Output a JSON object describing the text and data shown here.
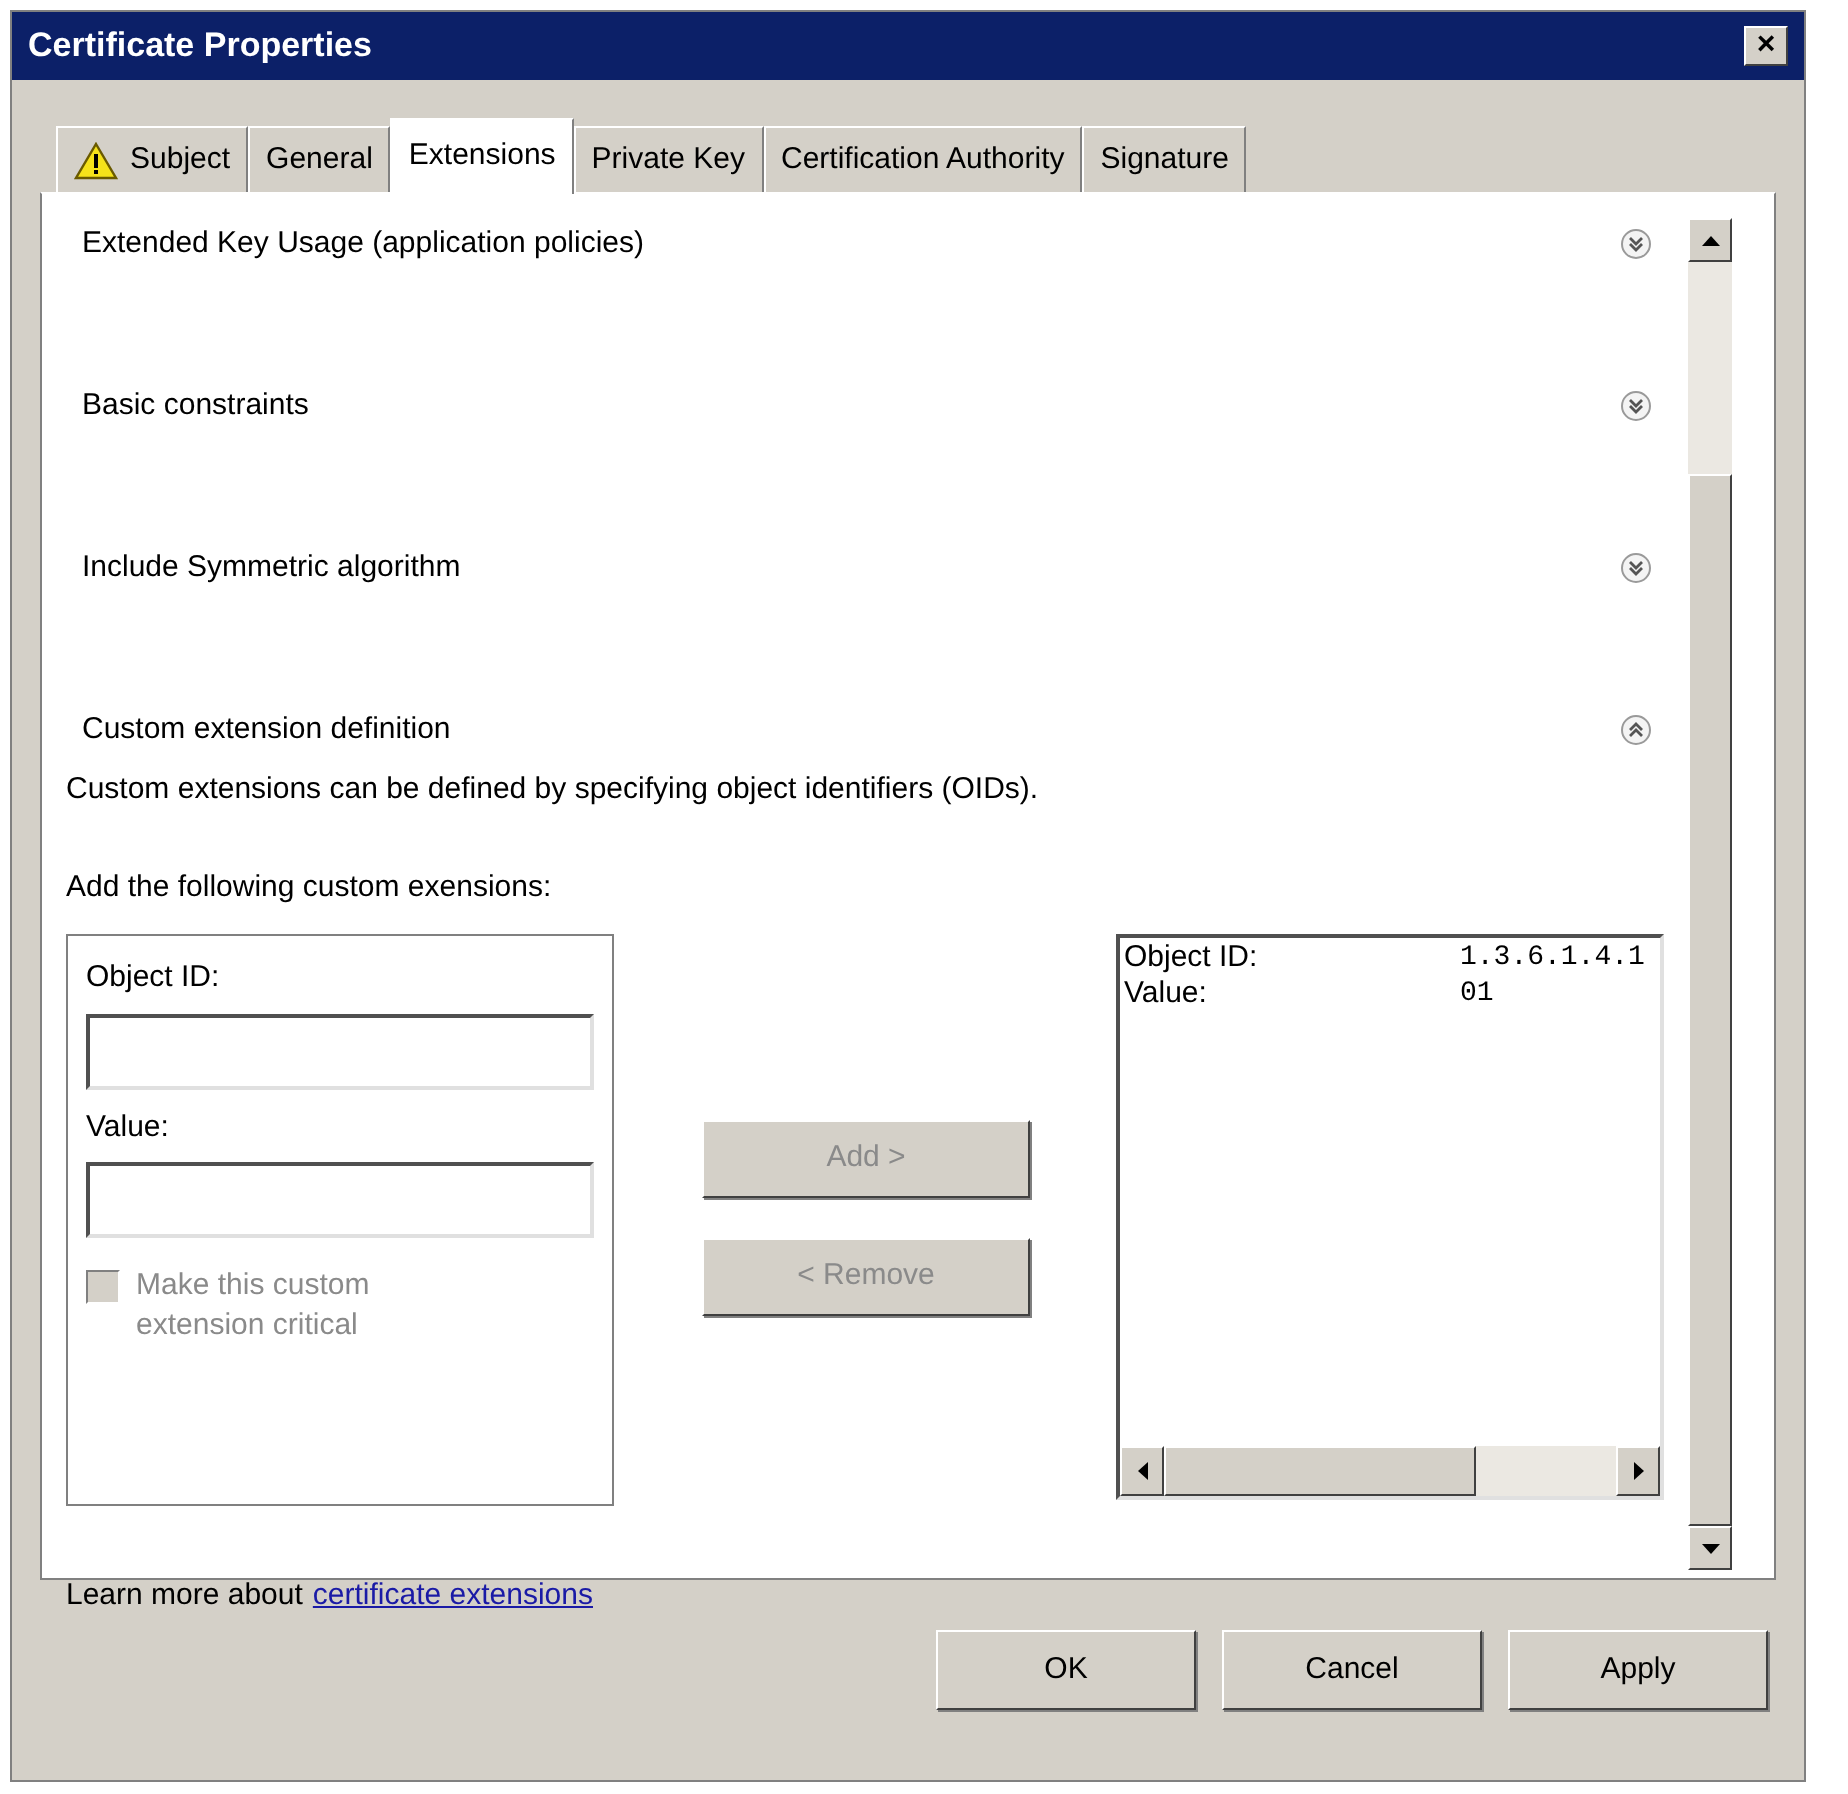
{
  "window": {
    "title": "Certificate Properties",
    "close_label": "×"
  },
  "tabs": [
    {
      "label": "Subject",
      "selected": false,
      "warning": true
    },
    {
      "label": "General",
      "selected": false,
      "warning": false
    },
    {
      "label": "Extensions",
      "selected": true,
      "warning": false
    },
    {
      "label": "Private Key",
      "selected": false,
      "warning": false
    },
    {
      "label": "Certification Authority",
      "selected": false,
      "warning": false
    },
    {
      "label": "Signature",
      "selected": false,
      "warning": false
    }
  ],
  "sections": [
    {
      "title": "Extended Key Usage (application policies)",
      "expanded": false
    },
    {
      "title": "Basic constraints",
      "expanded": false
    },
    {
      "title": "Include Symmetric algorithm",
      "expanded": false
    },
    {
      "title": "Custom extension definition",
      "expanded": true
    }
  ],
  "custom": {
    "description": "Custom extensions can be defined by specifying object identifiers (OIDs).",
    "add_label": "Add the following custom exensions:",
    "object_id_label": "Object ID:",
    "value_label": "Value:",
    "critical": {
      "label": "Make this custom extension critical",
      "checked": false,
      "disabled": true
    },
    "buttons": [
      {
        "label": "Add >",
        "disabled": true
      },
      {
        "label": "< Remove",
        "disabled": true
      }
    ],
    "list": [
      {
        "label": "Object ID:",
        "value": "1.3.6.1.4.1"
      },
      {
        "label": "Value:",
        "value": "01"
      }
    ]
  },
  "learn_more": {
    "text": "Learn more about",
    "link": "certificate extensions"
  },
  "buttons": [
    {
      "label": "OK",
      "disabled": false
    },
    {
      "label": "Cancel",
      "disabled": false
    },
    {
      "label": "Apply",
      "disabled": false
    }
  ]
}
